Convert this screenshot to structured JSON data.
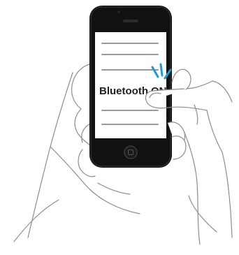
{
  "screen": {
    "label_text": "Bluetooth",
    "state_text": "ON"
  },
  "colors": {
    "phone_body": "#111111",
    "screen_bg": "#ffffff",
    "screen_lines": "#9a9a9a",
    "tap_accent": "#1a9ad6",
    "hand_stroke": "#8c8c8c",
    "label_text": "#222222"
  },
  "icons": {
    "earpiece": "speaker-slot-icon",
    "home": "home-button-icon",
    "tap": "tap-indicator-icon"
  }
}
